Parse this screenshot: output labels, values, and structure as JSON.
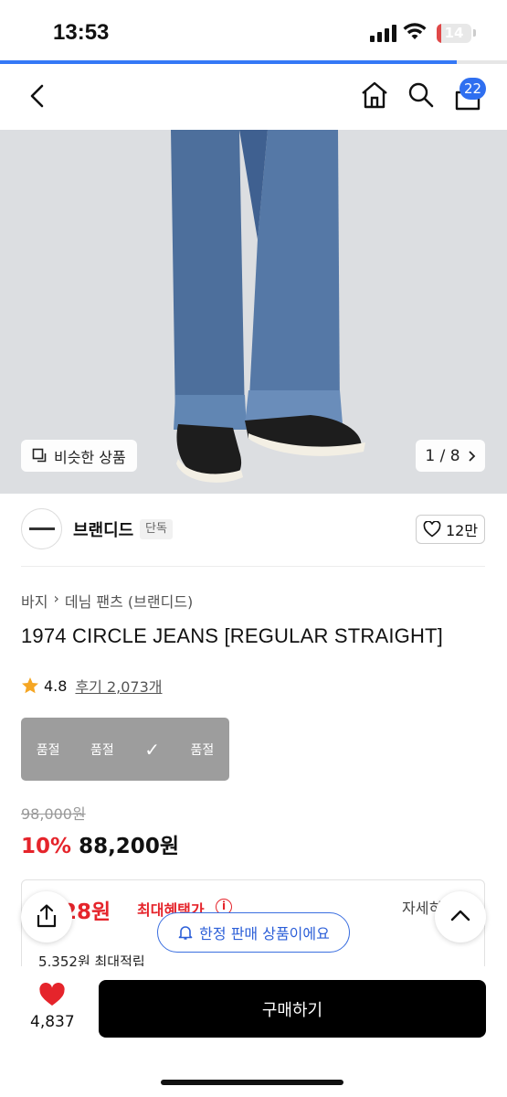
{
  "status_bar": {
    "time": "13:53",
    "battery": "14",
    "battery_level": 0.14
  },
  "page_progress": 0.9,
  "nav": {
    "cart_count": "22",
    "icons": [
      "back-arrow-icon",
      "home-icon",
      "search-icon",
      "cart-icon"
    ]
  },
  "gallery": {
    "similar_label": "비슷한 상품",
    "pager": "1 / 8"
  },
  "brand": {
    "name": "브랜디드",
    "tag": "단독",
    "likes": "12만"
  },
  "breadcrumb": {
    "category": "바지",
    "sub": "데님 팬츠 (브랜디드)"
  },
  "product": {
    "title": "1974 CIRCLE JEANS [REGULAR STRAIGHT]",
    "rating": "4.8",
    "reviews": "후기 2,073개"
  },
  "options": [
    "품절",
    "품절",
    "✓",
    "품절"
  ],
  "price": {
    "original": "98,000원",
    "discount": "10%",
    "sale": "88,200원"
  },
  "benefit": {
    "price": "528원",
    "label": "최대혜택가",
    "detail": "자세히",
    "points": "5,352원 최대적립"
  },
  "notice": "한정 판매 상품이에요",
  "bottom": {
    "wish_count": "4,837",
    "buy_label": "구매하기"
  },
  "colors": {
    "accent_blue": "#2f6ff0",
    "sale_red": "#e5242b",
    "buy_black": "#000000"
  }
}
